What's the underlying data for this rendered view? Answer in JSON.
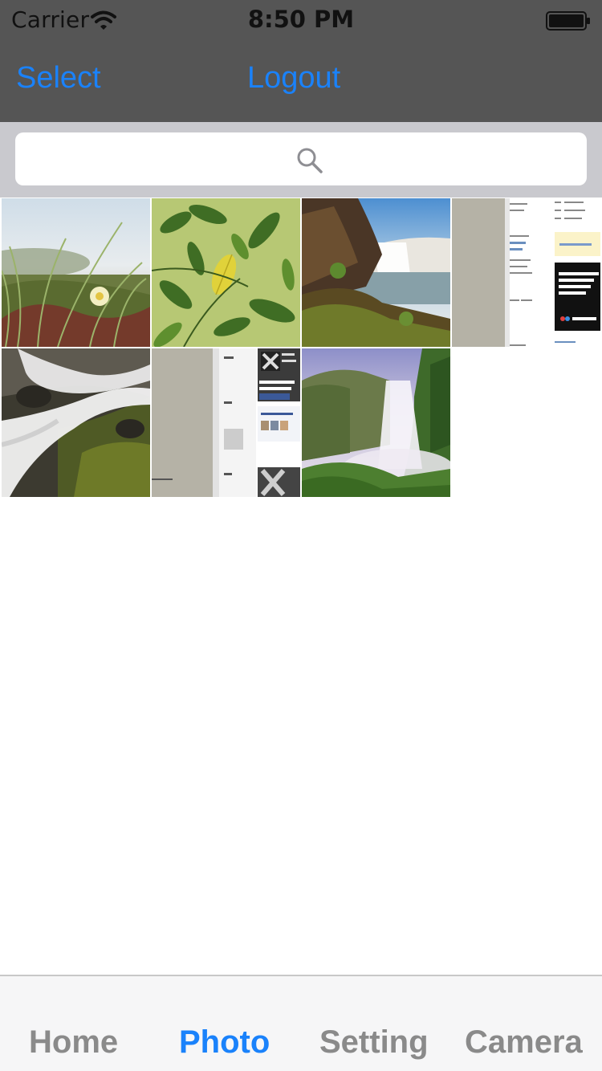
{
  "status_bar": {
    "carrier": "Carrier",
    "time": "8:50 PM",
    "wifi_icon": "wifi-icon",
    "battery_icon": "battery-icon"
  },
  "nav": {
    "left_label": "Select",
    "right_label": "Logout",
    "accent_color": "#1a82fb"
  },
  "search": {
    "placeholder": "",
    "icon": "search-icon"
  },
  "photos": [
    {
      "name": "ice plant flower with dune grass"
    },
    {
      "name": "green leaves with yellow leaf"
    },
    {
      "name": "waterfall on mossy cliff"
    },
    {
      "name": "screenshot of a web page"
    },
    {
      "name": "long exposure waterfall with rocks"
    },
    {
      "name": "screenshot of a social web page"
    },
    {
      "name": "misty waterfall in green valley"
    }
  ],
  "tabs": [
    {
      "label": "Home",
      "active": false
    },
    {
      "label": "Photo",
      "active": true
    },
    {
      "label": "Setting",
      "active": false
    },
    {
      "label": "Camera",
      "active": false
    }
  ],
  "colors": {
    "bar_gray": "#555555",
    "search_bg": "#c9c9ce",
    "tab_inactive": "#8a8a8a",
    "tab_active": "#1a82fb"
  }
}
